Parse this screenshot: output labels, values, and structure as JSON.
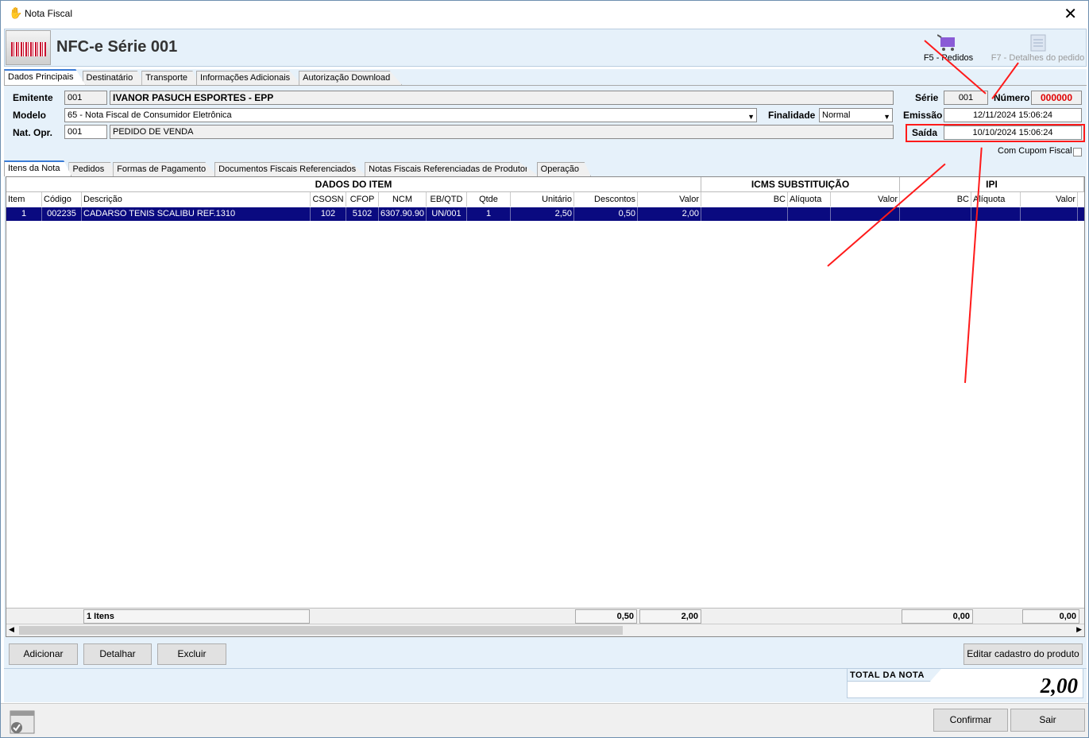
{
  "window": {
    "title": "Nota Fiscal",
    "heading": "NFC-e Série 001"
  },
  "toolbar": {
    "pedidos": "F5 - Pedidos",
    "detalhes": "F7 - Detalhes do pedido"
  },
  "main_tabs": [
    "Dados Principais",
    "Destinatário",
    "Transporte",
    "Informações Adicionais",
    "Autorização Download"
  ],
  "form": {
    "emitente_label": "Emitente",
    "emitente_code": "001",
    "emitente_name": "IVANOR PASUCH ESPORTES - EPP",
    "modelo_label": "Modelo",
    "modelo_value": "65 - Nota Fiscal de Consumidor Eletrônica",
    "finalidade_label": "Finalidade",
    "finalidade_value": "Normal",
    "natopr_label": "Nat. Opr.",
    "natopr_code": "001",
    "natopr_desc": "PEDIDO DE VENDA",
    "serie_label": "Série",
    "serie_value": "001",
    "numero_label": "Número",
    "numero_value": "000000",
    "emissao_label": "Emissão",
    "emissao_value": "12/11/2024 15:06:24",
    "saida_label": "Saída",
    "saida_value": "10/10/2024 15:06:24",
    "cupom_label": "Com Cupom Fiscal"
  },
  "sub_tabs": [
    "Itens da Nota",
    "Pedidos",
    "Formas de Pagamento",
    "Documentos Fiscais Referenciados",
    "Notas Fiscais Referenciadas de Produtor",
    "Operação"
  ],
  "grid": {
    "group_item": "DADOS DO ITEM",
    "group_icms": "ICMS SUBSTITUIÇÃO",
    "group_ipi": "IPI",
    "columns": [
      "Item",
      "Código",
      "Descrição",
      "CSOSN",
      "CFOP",
      "NCM",
      "EB/QTD",
      "Qtde",
      "Unitário",
      "Descontos",
      "Valor",
      "BC",
      "Alíquota",
      "Valor",
      "BC",
      "Alíquota",
      "Valor"
    ],
    "rows": [
      [
        "1",
        "002235",
        "CADARSO TENIS SCALIBU REF.1310",
        "102",
        "5102",
        "6307.90.90",
        "UN/001",
        "1",
        "2,50",
        "0,50",
        "2,00",
        "",
        "",
        "",
        "",
        "",
        ""
      ]
    ],
    "footer": {
      "count": "1 Itens",
      "descontos": "0,50",
      "valor": "2,00",
      "icms_valor": "0,00",
      "ipi_valor": "0,00"
    }
  },
  "buttons": {
    "adicionar": "Adicionar",
    "detalhar": "Detalhar",
    "excluir": "Excluir",
    "editar": "Editar cadastro do produto",
    "confirmar": "Confirmar",
    "sair": "Sair"
  },
  "total": {
    "label": "TOTAL DA NOTA",
    "value": "2,00"
  },
  "colors": {
    "accent": "#3a7bd5",
    "selection": "#0a0a80",
    "numero": "#e00000",
    "annotation": "#ff1a1a"
  }
}
